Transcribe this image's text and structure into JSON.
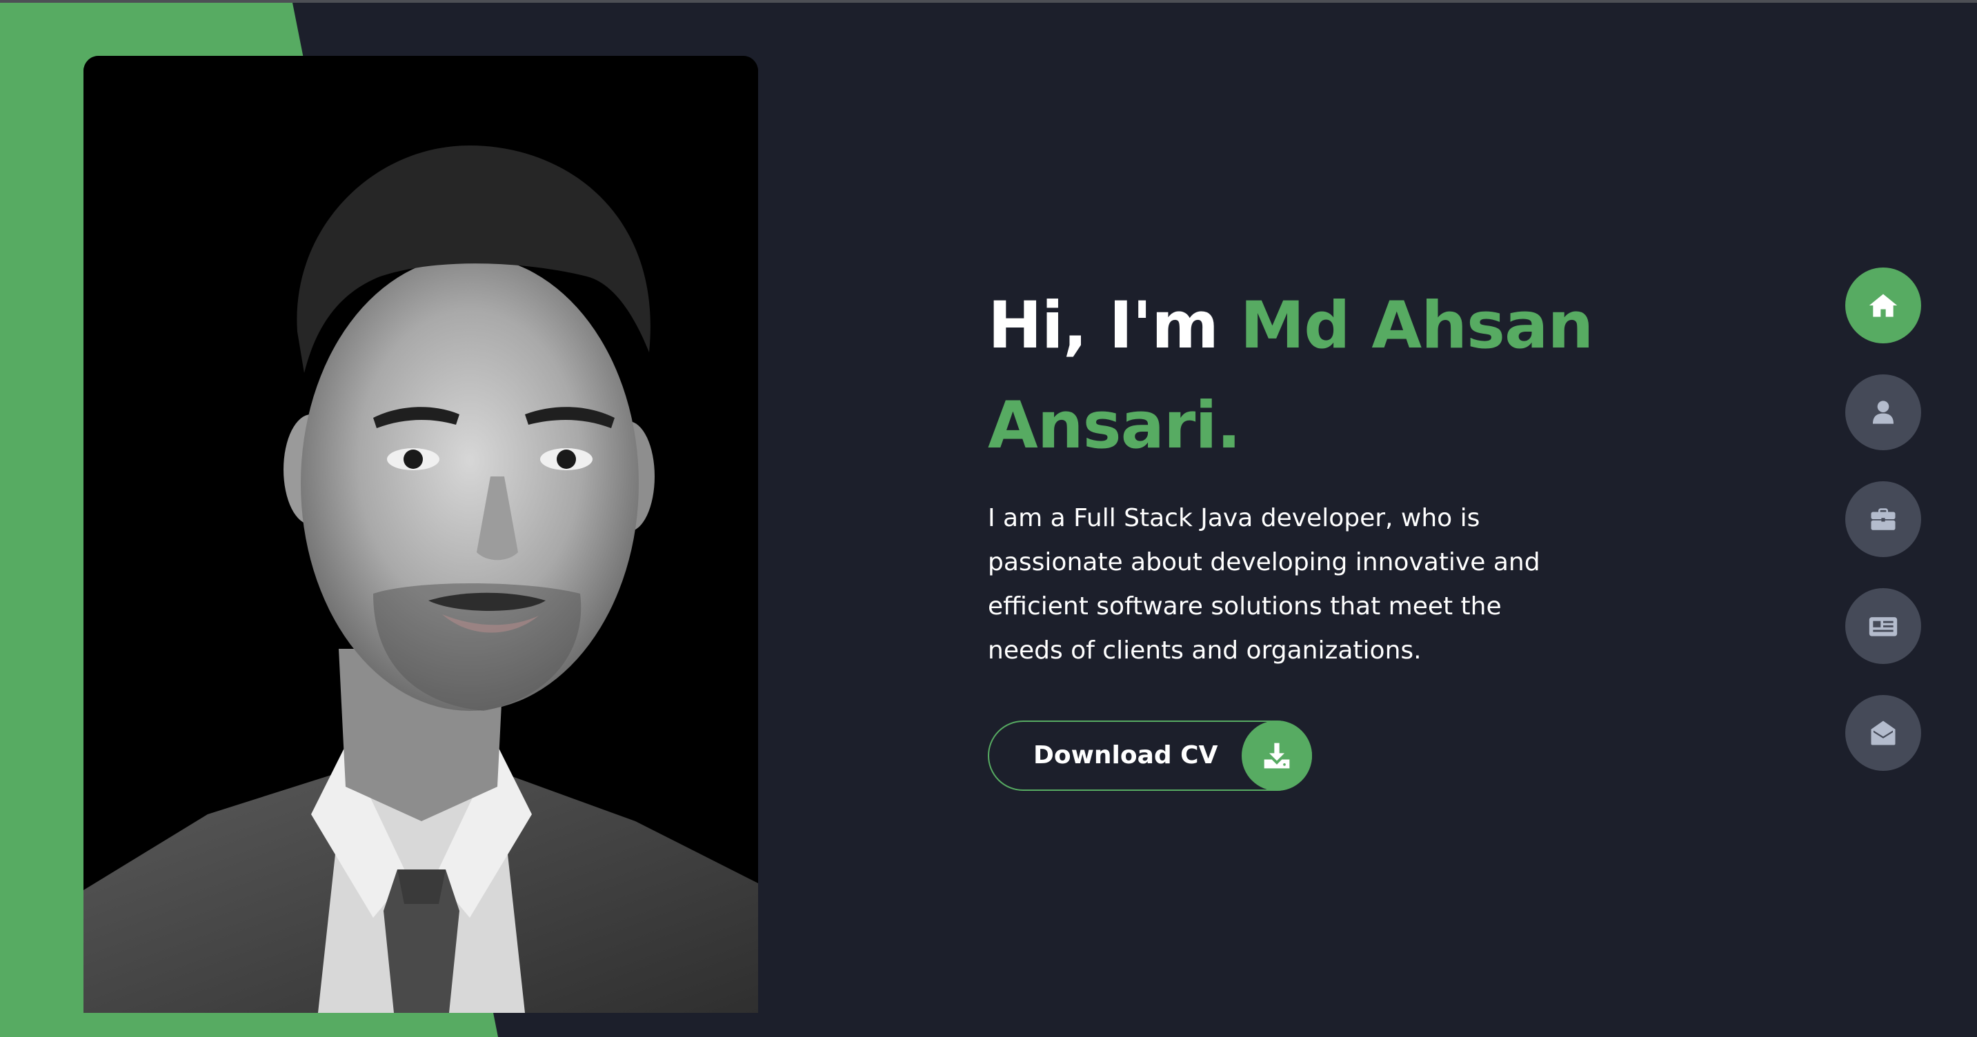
{
  "hero": {
    "greeting": "Hi, I'm",
    "name_line1": "Md Ahsan",
    "name_line2": "Ansari.",
    "bio": "I am a Full Stack Java developer, who is passionate about developing innovative and efficient software solutions that meet the needs of clients and organizations."
  },
  "cv_button": {
    "label": "Download CV",
    "icon": "download-icon"
  },
  "nav": [
    {
      "icon": "home-icon",
      "active": true
    },
    {
      "icon": "user-icon",
      "active": false
    },
    {
      "icon": "briefcase-icon",
      "active": false
    },
    {
      "icon": "newspaper-icon",
      "active": false
    },
    {
      "icon": "envelope-open-icon",
      "active": false
    }
  ],
  "colors": {
    "accent": "#57ab62",
    "background": "#1c1f2b",
    "nav_inactive": "#454a58",
    "nav_icon_inactive": "#b4bccd",
    "text": "#ffffff"
  }
}
